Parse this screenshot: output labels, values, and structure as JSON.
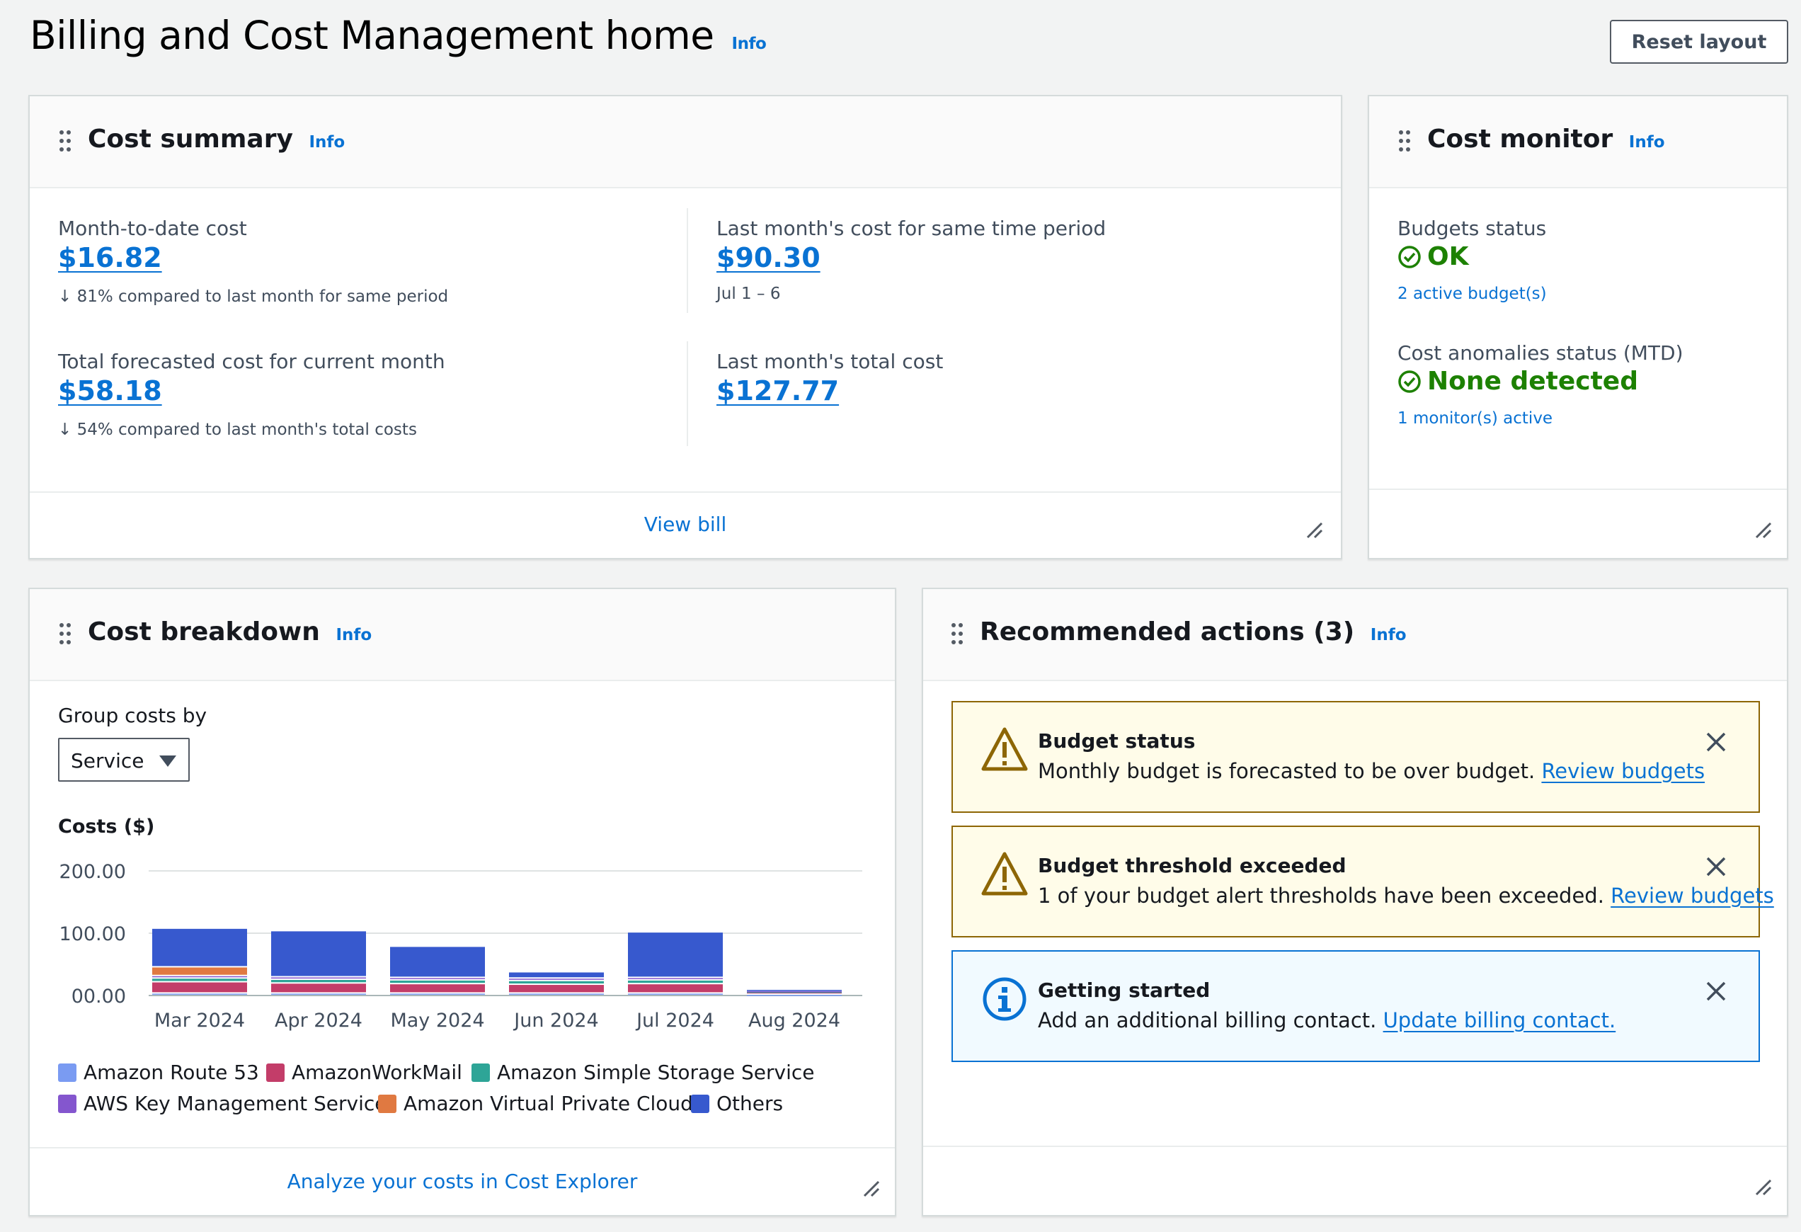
{
  "page": {
    "title": "Billing and Cost Management home",
    "info": "Info",
    "reset_layout": "Reset layout"
  },
  "cost_summary": {
    "title": "Cost summary",
    "info": "Info",
    "mtd_label": "Month-to-date cost",
    "mtd_value": "$16.82",
    "mtd_compare": "81% compared to last month for same period",
    "last_same_label": "Last month's cost for same time period",
    "last_same_value": "$90.30",
    "last_same_range": "Jul 1 – 6",
    "forecast_label": "Total forecasted cost for current month",
    "forecast_value": "$58.18",
    "forecast_compare": "54% compared to last month's total costs",
    "last_total_label": "Last month's total cost",
    "last_total_value": "$127.77",
    "footer_link": "View bill"
  },
  "cost_monitor": {
    "title": "Cost monitor",
    "info": "Info",
    "budgets_label": "Budgets status",
    "budgets_status": "OK",
    "budgets_link": "2 active budget(s)",
    "anomalies_label": "Cost anomalies status (MTD)",
    "anomalies_status": "None detected",
    "anomalies_link": "1 monitor(s) active"
  },
  "cost_breakdown": {
    "title": "Cost breakdown",
    "info": "Info",
    "group_label": "Group costs by",
    "group_value": "Service",
    "footer_link": "Analyze your costs in Cost Explorer"
  },
  "recommended": {
    "title": "Recommended actions (3)",
    "info": "Info",
    "alerts": [
      {
        "title": "Budget status",
        "body": "Monthly budget is forecasted to be over budget.",
        "link": "Review budgets",
        "type": "warning"
      },
      {
        "title": "Budget threshold exceeded",
        "body": "1 of your budget alert thresholds have been exceeded.",
        "link": "Review budgets",
        "type": "warning"
      },
      {
        "title": "Getting started",
        "body": "Add an additional billing contact.",
        "link": "Update billing contact.",
        "type": "info"
      }
    ]
  },
  "chart_data": {
    "type": "bar",
    "stacked": true,
    "title": "Costs ($)",
    "categories": [
      "Mar 2024",
      "Apr 2024",
      "May 2024",
      "Jun 2024",
      "Jul 2024",
      "Aug 2024"
    ],
    "y_ticks": [
      "200.00",
      "100.00",
      "00.00"
    ],
    "ylim": [
      0,
      200
    ],
    "grid": true,
    "legend_position": "bottom",
    "series": [
      {
        "name": "Amazon Route 53",
        "color": "#7a9bf2",
        "values": [
          3,
          3,
          3,
          3,
          3,
          1
        ]
      },
      {
        "name": "AmazonWorkMail",
        "color": "#c33d69",
        "values": [
          18,
          16,
          15,
          14,
          15,
          4
        ]
      },
      {
        "name": "Amazon Simple Storage Service",
        "color": "#2ea597",
        "values": [
          6,
          6,
          6,
          6,
          6,
          1
        ]
      },
      {
        "name": "AWS Key Management Service",
        "color": "#8456ce",
        "values": [
          4,
          4,
          4,
          4,
          4,
          1
        ]
      },
      {
        "name": "Amazon Virtual Private Cloud",
        "color": "#e07941",
        "values": [
          14,
          0,
          0,
          0,
          0,
          0
        ]
      },
      {
        "name": "Others",
        "color": "#3759ce",
        "values": [
          62,
          74,
          50,
          10,
          73,
          2
        ]
      }
    ]
  }
}
